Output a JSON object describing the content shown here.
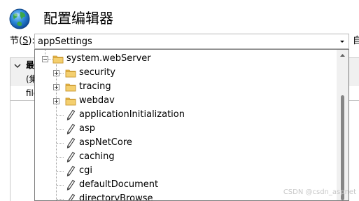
{
  "header": {
    "title": "配置编辑器",
    "icon": "globe-icon"
  },
  "section": {
    "label_prefix": "节(",
    "label_accel": "S",
    "label_suffix": "):",
    "value": "appSettings",
    "right_cut_text": "自"
  },
  "background_grid": {
    "row1_text": "最",
    "row2_text": "(集",
    "row3_text": "file"
  },
  "tree": {
    "items": [
      {
        "label": "system.webServer",
        "type": "folder",
        "expander": "minus"
      },
      {
        "label": "security",
        "type": "folder",
        "expander": "plus"
      },
      {
        "label": "tracing",
        "type": "folder",
        "expander": "plus"
      },
      {
        "label": "webdav",
        "type": "folder",
        "expander": "plus"
      },
      {
        "label": "applicationInitialization",
        "type": "section"
      },
      {
        "label": "asp",
        "type": "section"
      },
      {
        "label": "aspNetCore",
        "type": "section"
      },
      {
        "label": "caching",
        "type": "section"
      },
      {
        "label": "cgi",
        "type": "section"
      },
      {
        "label": "defaultDocument",
        "type": "section"
      },
      {
        "label": "directoryBrowse",
        "type": "section"
      }
    ]
  },
  "watermark": "CSDN @csdn_aspnet",
  "colors": {
    "folder": "#e8b84a",
    "folder_dark": "#c9962e",
    "pen": "#3a3a3a",
    "border": "#7a7a7a",
    "scroll_thumb": "#858585"
  }
}
